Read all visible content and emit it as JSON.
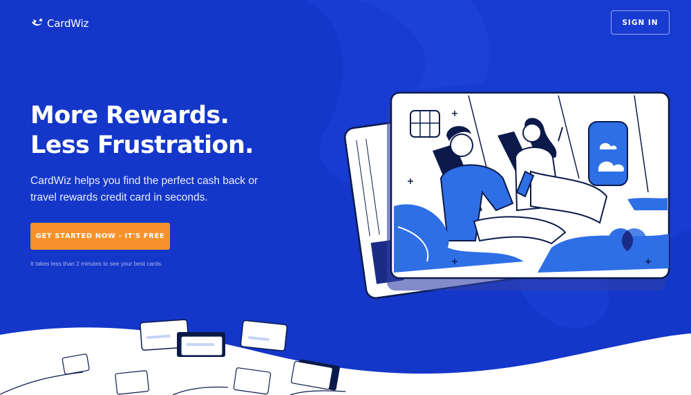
{
  "brand": {
    "name": "CardWiz"
  },
  "header": {
    "signin_label": "SIGN IN"
  },
  "hero": {
    "headline_line1": "More Rewards.",
    "headline_line2": "Less Frustration.",
    "subhead": "CardWiz helps you find the perfect cash back or travel rewards credit card in seconds.",
    "cta_label": "GET STARTED NOW - IT'S FREE",
    "note": "It takes less than 2 minutes to see your best cards."
  },
  "colors": {
    "background": "#1437c9",
    "accent_orange": "#f7922a",
    "illustration_blue": "#2f6fe6",
    "white": "#ffffff"
  },
  "icons": [
    "cardwiz-logo-icon",
    "card-chip-icon",
    "mastercard-logo-icon"
  ]
}
